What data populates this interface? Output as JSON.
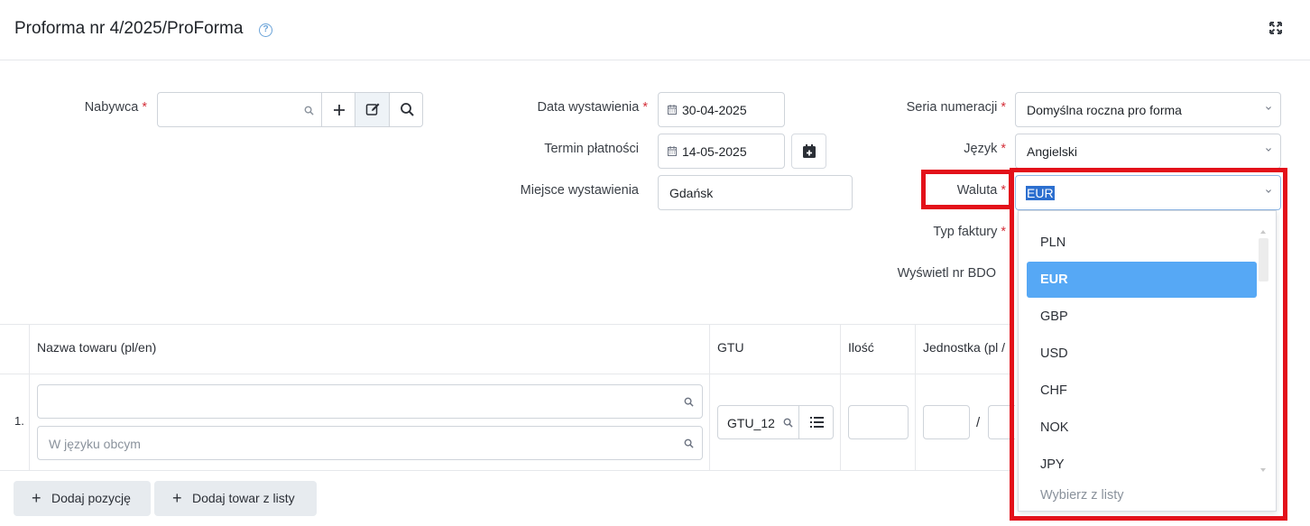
{
  "header": {
    "title": "Proforma nr 4/2025/ProForma",
    "help_icon": "?",
    "expand_icon": "expand-icon"
  },
  "form": {
    "buyer": {
      "label": "Nabywca",
      "required": "*",
      "value": ""
    },
    "issue_date": {
      "label": "Data wystawienia",
      "required": "*",
      "value": "30-04-2025"
    },
    "payment_due": {
      "label": "Termin płatności",
      "value": "14-05-2025"
    },
    "place": {
      "label": "Miejsce wystawienia",
      "value": "Gdańsk"
    },
    "series": {
      "label": "Seria numeracji",
      "required": "*",
      "value": "Domyślna roczna pro forma"
    },
    "language": {
      "label": "Język",
      "required": "*",
      "value": "Angielski"
    },
    "currency": {
      "label": "Waluta",
      "required": "*",
      "value": "EUR"
    },
    "invoice_type": {
      "label": "Typ faktury",
      "required": "*"
    },
    "show_bdo": {
      "label": "Wyświetl nr BDO"
    }
  },
  "currency_dropdown": {
    "options": [
      "PLN",
      "EUR",
      "GBP",
      "USD",
      "CHF",
      "NOK",
      "JPY"
    ],
    "selected": "EUR",
    "footer": "Wybierz z listy"
  },
  "table": {
    "columns": [
      "Nazwa towaru (pl/en)",
      "GTU",
      "Ilość",
      "Jednostka (pl /"
    ],
    "rows": [
      {
        "index": "1.",
        "name": "",
        "foreign_placeholder": "W języku obcym",
        "gtu": "GTU_12",
        "qty": "",
        "unit_pl": "",
        "unit_sep": "/"
      }
    ]
  },
  "actions": {
    "add_position": "Dodaj pozycję",
    "add_from_list": "Dodaj towar z listy"
  },
  "colors": {
    "accent": "#56a8f5",
    "highlight": "#e3101a",
    "required": "#d4303a"
  }
}
